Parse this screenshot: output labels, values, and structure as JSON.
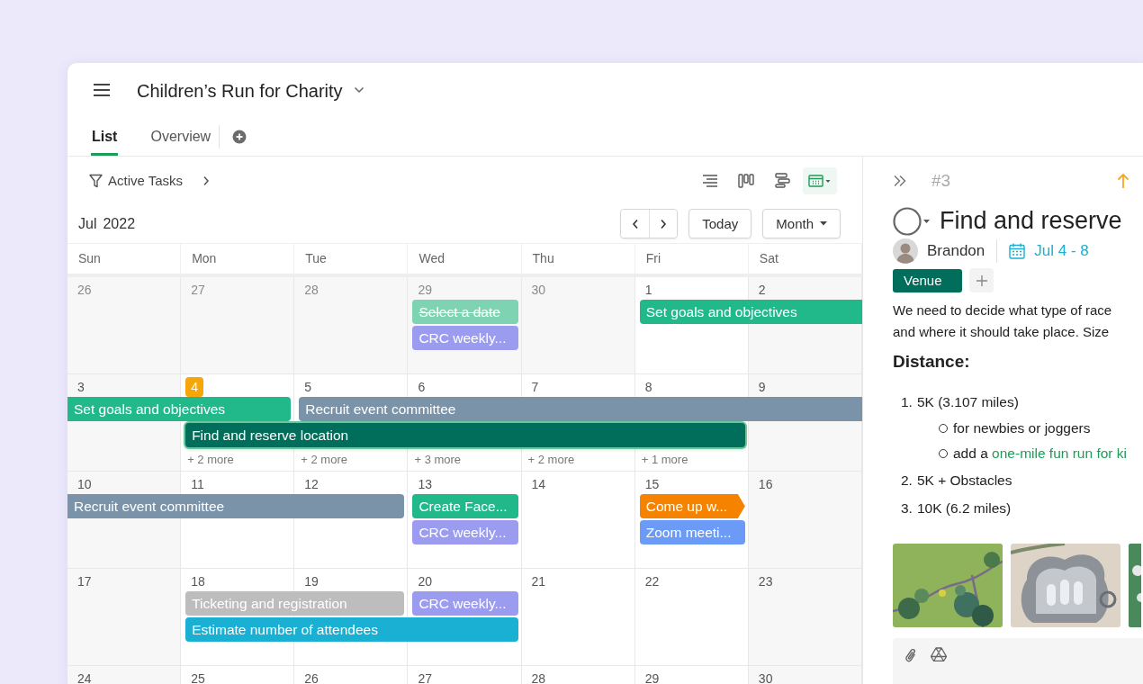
{
  "project": {
    "title": "Children’s Run for Charity"
  },
  "tabs": [
    {
      "label": "List",
      "selected": true
    },
    {
      "label": "Overview",
      "selected": false
    }
  ],
  "filter": {
    "label": "Active Tasks"
  },
  "views": [
    {
      "kind": "list",
      "selected": false
    },
    {
      "kind": "board",
      "selected": false
    },
    {
      "kind": "gantt",
      "selected": false
    },
    {
      "kind": "calendar",
      "selected": true
    }
  ],
  "calendar": {
    "month": "Jul",
    "year": "2022",
    "today_button": "Today",
    "range": "Month",
    "weekdays": [
      "Sun",
      "Mon",
      "Tue",
      "Wed",
      "Thu",
      "Fri",
      "Sat"
    ]
  },
  "weeks": [
    {
      "days": [
        {
          "number": "26",
          "outside": true,
          "today": false
        },
        {
          "number": "27",
          "outside": true,
          "today": false
        },
        {
          "number": "28",
          "outside": true,
          "today": false
        },
        {
          "number": "29",
          "outside": true,
          "today": false
        },
        {
          "number": "30",
          "outside": true,
          "today": false
        },
        {
          "number": "1",
          "outside": false,
          "today": false
        },
        {
          "number": "2",
          "outside": false,
          "today": false
        }
      ],
      "lanes": [
        [
          {
            "kind": "empty"
          },
          {
            "kind": "empty"
          },
          {
            "kind": "empty"
          },
          {
            "kind": "event",
            "label": "Select a date",
            "color": "#7ed3b3",
            "done": true,
            "selected": false,
            "pointed": false
          },
          {
            "kind": "empty"
          },
          {
            "kind": "event",
            "label": "Set goals and objectives",
            "color": "#22b98a",
            "done": false,
            "selected": false,
            "pointed": false
          },
          {
            "kind": "continued"
          }
        ],
        [
          {
            "kind": "empty"
          },
          {
            "kind": "empty"
          },
          {
            "kind": "empty"
          },
          {
            "kind": "event",
            "label": "CRC weekly...",
            "color": "#9b9cf0",
            "done": false,
            "selected": false,
            "pointed": false
          },
          {
            "kind": "empty"
          },
          {
            "kind": "empty"
          },
          {
            "kind": "empty"
          }
        ]
      ]
    },
    {
      "days": [
        {
          "number": "3",
          "outside": false,
          "today": false
        },
        {
          "number": "4",
          "outside": false,
          "today": true
        },
        {
          "number": "5",
          "outside": false,
          "today": false
        },
        {
          "number": "6",
          "outside": false,
          "today": false
        },
        {
          "number": "7",
          "outside": false,
          "today": false
        },
        {
          "number": "8",
          "outside": false,
          "today": false
        },
        {
          "number": "9",
          "outside": false,
          "today": false
        }
      ],
      "lanes": [
        [
          {
            "kind": "event",
            "label": "Set goals and objectives",
            "color": "#22b98a",
            "done": false,
            "selected": false,
            "pointed": false
          },
          {
            "kind": "continued"
          },
          {
            "kind": "event",
            "label": "Recruit event committee",
            "color": "#7a93a8",
            "done": false,
            "selected": false,
            "pointed": false
          },
          {
            "kind": "continued"
          },
          {
            "kind": "continued"
          },
          {
            "kind": "continued"
          },
          {
            "kind": "continued"
          }
        ],
        [
          {
            "kind": "empty"
          },
          {
            "kind": "event",
            "label": "Find and reserve location",
            "color": "#006e5a",
            "done": false,
            "selected": true,
            "pointed": false
          },
          {
            "kind": "continued"
          },
          {
            "kind": "continued"
          },
          {
            "kind": "continued"
          },
          {
            "kind": "continued"
          },
          {
            "kind": "empty"
          }
        ],
        [
          {
            "kind": "empty"
          },
          {
            "kind": "more",
            "label": "+ 2 more"
          },
          {
            "kind": "more",
            "label": "+ 2 more"
          },
          {
            "kind": "more",
            "label": "+ 3 more"
          },
          {
            "kind": "more",
            "label": "+ 2 more"
          },
          {
            "kind": "more",
            "label": "+ 1 more"
          },
          {
            "kind": "empty"
          }
        ]
      ]
    },
    {
      "days": [
        {
          "number": "10",
          "outside": false,
          "today": false
        },
        {
          "number": "11",
          "outside": false,
          "today": false
        },
        {
          "number": "12",
          "outside": false,
          "today": false
        },
        {
          "number": "13",
          "outside": false,
          "today": false
        },
        {
          "number": "14",
          "outside": false,
          "today": false
        },
        {
          "number": "15",
          "outside": false,
          "today": false
        },
        {
          "number": "16",
          "outside": false,
          "today": false
        }
      ],
      "lanes": [
        [
          {
            "kind": "event",
            "label": "Recruit event committee",
            "color": "#7a93a8",
            "done": false,
            "selected": false,
            "pointed": false
          },
          {
            "kind": "continued"
          },
          {
            "kind": "continued"
          },
          {
            "kind": "event",
            "label": "Create Face...",
            "color": "#22b98a",
            "done": false,
            "selected": false,
            "pointed": false
          },
          {
            "kind": "empty"
          },
          {
            "kind": "event",
            "label": "Come up w...",
            "color": "#f58300",
            "done": false,
            "selected": false,
            "pointed": true
          },
          {
            "kind": "empty"
          }
        ],
        [
          {
            "kind": "empty"
          },
          {
            "kind": "empty"
          },
          {
            "kind": "empty"
          },
          {
            "kind": "event",
            "label": "CRC weekly...",
            "color": "#9b9cf0",
            "done": false,
            "selected": false,
            "pointed": false
          },
          {
            "kind": "empty"
          },
          {
            "kind": "event",
            "label": "Zoom meeti...",
            "color": "#6b9bf7",
            "done": false,
            "selected": false,
            "pointed": false
          },
          {
            "kind": "empty"
          }
        ]
      ]
    },
    {
      "days": [
        {
          "number": "17",
          "outside": false,
          "today": false
        },
        {
          "number": "18",
          "outside": false,
          "today": false
        },
        {
          "number": "19",
          "outside": false,
          "today": false
        },
        {
          "number": "20",
          "outside": false,
          "today": false
        },
        {
          "number": "21",
          "outside": false,
          "today": false
        },
        {
          "number": "22",
          "outside": false,
          "today": false
        },
        {
          "number": "23",
          "outside": false,
          "today": false
        }
      ],
      "lanes": [
        [
          {
            "kind": "empty"
          },
          {
            "kind": "event",
            "label": "Ticketing and registration",
            "color": "#bdbdbd",
            "done": false,
            "selected": false,
            "pointed": false
          },
          {
            "kind": "continued"
          },
          {
            "kind": "event",
            "label": "CRC weekly...",
            "color": "#9b9cf0",
            "done": false,
            "selected": false,
            "pointed": false
          },
          {
            "kind": "empty"
          },
          {
            "kind": "empty"
          },
          {
            "kind": "empty"
          }
        ],
        [
          {
            "kind": "empty"
          },
          {
            "kind": "event",
            "label": "Estimate number of attendees",
            "color": "#1ab0d3",
            "done": false,
            "selected": false,
            "pointed": false
          },
          {
            "kind": "continued"
          },
          {
            "kind": "continued"
          },
          {
            "kind": "empty"
          },
          {
            "kind": "empty"
          },
          {
            "kind": "empty"
          }
        ]
      ]
    },
    {
      "days": [
        {
          "number": "24",
          "outside": false,
          "today": false
        },
        {
          "number": "25",
          "outside": false,
          "today": false
        },
        {
          "number": "26",
          "outside": false,
          "today": false
        },
        {
          "number": "27",
          "outside": false,
          "today": false
        },
        {
          "number": "28",
          "outside": false,
          "today": false
        },
        {
          "number": "29",
          "outside": false,
          "today": false
        },
        {
          "number": "30",
          "outside": false,
          "today": false
        }
      ]
    }
  ],
  "detail": {
    "number": "#3",
    "title": "Find and reserve",
    "assignee": "Brandon",
    "dates": "Jul 4 - 8",
    "tags": [
      {
        "label": "Venue",
        "color": "#006e5a"
      }
    ],
    "description": [
      "We need to decide what type of race",
      "and where it should take place. Size"
    ],
    "heading": "Distance:",
    "options": [
      {
        "number": "1.",
        "text": "5K (3.107 miles)",
        "children": [
          {
            "segments": [
              {
                "text": "for newbies or joggers"
              }
            ]
          },
          {
            "segments": [
              {
                "text": "add a "
              },
              {
                "text": "one-mile fun run for ki",
                "kind": "link"
              }
            ]
          }
        ]
      },
      {
        "number": "2.",
        "text": "5K + Obstacles"
      },
      {
        "number": "3.",
        "text": "10K (6.2 miles)"
      }
    ],
    "attachments": [
      {
        "kind": "picture"
      },
      {
        "kind": "picture"
      },
      {
        "kind": "picture"
      }
    ]
  }
}
